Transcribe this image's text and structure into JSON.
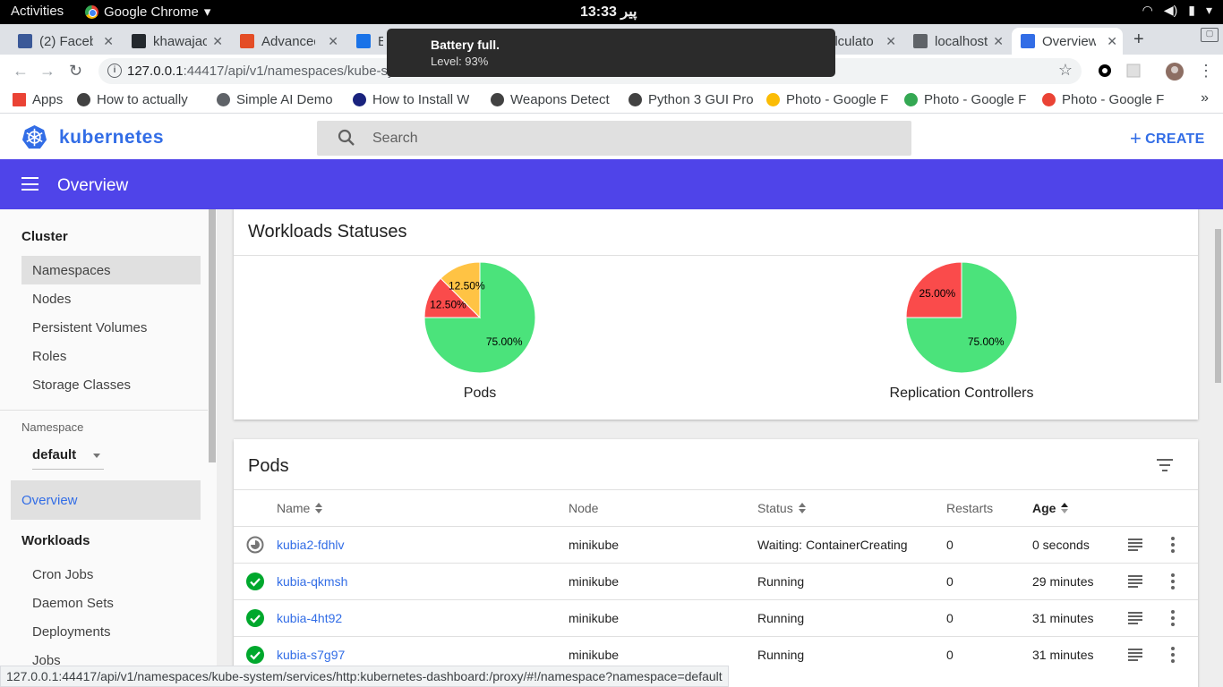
{
  "system": {
    "activities": "Activities",
    "app_name": "Google Chrome",
    "clock": "13:33 پیر"
  },
  "tabs": [
    {
      "title": "(2) Faceb",
      "favicon": "facebook-icon",
      "color": "#3b5998"
    },
    {
      "title": "khawajac",
      "favicon": "github-icon",
      "color": "#24292e"
    },
    {
      "title": "Advanced",
      "favicon": "html-icon",
      "color": "#e44d26"
    },
    {
      "title": "Ex",
      "favicon": "kite-icon",
      "color": "#1a73e8"
    },
    {
      "title": "alculato",
      "favicon": "page-icon",
      "color": "#5f6368"
    },
    {
      "title": "localhost",
      "favicon": "page-icon",
      "color": "#5f6368"
    },
    {
      "title": "Overview",
      "favicon": "kubernetes-icon",
      "color": "#326de6"
    }
  ],
  "notification": {
    "title": "Battery full.",
    "body": "Level: 93%"
  },
  "omnibox": {
    "url_host": "127.0.0.1",
    "url_rest": ":44417/api/v1/namespaces/kube-sys",
    "url_tail": "c"
  },
  "bookmarks": [
    {
      "label": "Apps",
      "icon": "apps-grid-icon"
    },
    {
      "label": "How to actually",
      "icon": "globe-icon"
    },
    {
      "label": "Simple AI Demo",
      "icon": "page-icon"
    },
    {
      "label": "How to Install W",
      "icon": "h-icon"
    },
    {
      "label": "Weapons Detect",
      "icon": "weapons-icon"
    },
    {
      "label": "Python 3 GUI Pro",
      "icon": "diamond-icon"
    },
    {
      "label": "Photo - Google F",
      "icon": "photos-icon"
    },
    {
      "label": "Photo - Google F",
      "icon": "photos-icon"
    },
    {
      "label": "Photo - Google F",
      "icon": "photos-icon"
    }
  ],
  "header": {
    "brand": "kubernetes",
    "search_placeholder": "Search",
    "create_label": "CREATE"
  },
  "appbar": {
    "title": "Overview"
  },
  "sidebar": {
    "cluster_title": "Cluster",
    "cluster_items": [
      "Namespaces",
      "Nodes",
      "Persistent Volumes",
      "Roles",
      "Storage Classes"
    ],
    "namespace_label": "Namespace",
    "namespace_value": "default",
    "overview_label": "Overview",
    "workloads_title": "Workloads",
    "workload_items": [
      "Cron Jobs",
      "Daemon Sets",
      "Deployments",
      "Jobs"
    ]
  },
  "workloads": {
    "title": "Workloads Statuses",
    "charts": [
      {
        "label": "Pods",
        "slices": [
          {
            "value": 75.0,
            "text": "75.00%",
            "color": "#4be37b"
          },
          {
            "value": 12.5,
            "text": "12.50%",
            "color": "#fa4b4b"
          },
          {
            "value": 12.5,
            "text": "12.50%",
            "color": "#ffc344"
          }
        ]
      },
      {
        "label": "Replication Controllers",
        "slices": [
          {
            "value": 75.0,
            "text": "75.00%",
            "color": "#4be37b"
          },
          {
            "value": 25.0,
            "text": "25.00%",
            "color": "#fa4b4b"
          }
        ]
      }
    ]
  },
  "pods": {
    "title": "Pods",
    "columns": {
      "name": "Name",
      "node": "Node",
      "status": "Status",
      "restarts": "Restarts",
      "age": "Age"
    },
    "rows": [
      {
        "state": "pending",
        "name": "kubia2-fdhlv",
        "node": "minikube",
        "status": "Waiting: ContainerCreating",
        "restarts": "0",
        "age": "0 seconds"
      },
      {
        "state": "ok",
        "name": "kubia-qkmsh",
        "node": "minikube",
        "status": "Running",
        "restarts": "0",
        "age": "29 minutes"
      },
      {
        "state": "ok",
        "name": "kubia-4ht92",
        "node": "minikube",
        "status": "Running",
        "restarts": "0",
        "age": "31 minutes"
      },
      {
        "state": "ok",
        "name": "kubia-s7g97",
        "node": "minikube",
        "status": "Running",
        "restarts": "0",
        "age": "31 minutes"
      }
    ]
  },
  "status_url": "127.0.0.1:44417/api/v1/namespaces/kube-system/services/http:kubernetes-dashboard:/proxy/#!/namespace?namespace=default"
}
